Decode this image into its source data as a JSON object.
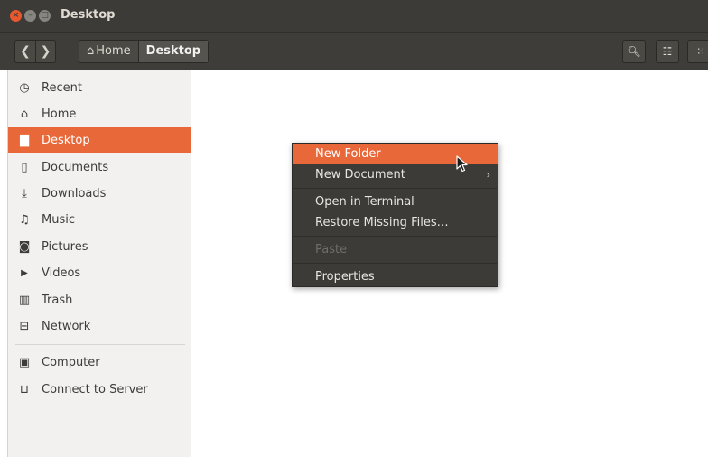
{
  "window": {
    "title": "Desktop",
    "controls": {
      "close": "×",
      "minimize": "–",
      "maximize": "□"
    }
  },
  "toolbar": {
    "back_glyph": "❮",
    "forward_glyph": "❯",
    "breadcrumbs": [
      {
        "label": "Home",
        "icon": "home-icon",
        "glyph": "⌂"
      },
      {
        "label": "Desktop"
      }
    ],
    "search_glyph": "🔍︎",
    "list_view_glyph": "☷",
    "grid_view_glyph": "⁙"
  },
  "sidebar": {
    "items": [
      {
        "label": "Recent",
        "icon": "clock-icon",
        "glyph": "◷"
      },
      {
        "label": "Home",
        "icon": "home-icon",
        "glyph": "⌂"
      },
      {
        "label": "Desktop",
        "icon": "folder-icon",
        "glyph": "▇",
        "selected": true
      },
      {
        "label": "Documents",
        "icon": "document-icon",
        "glyph": "▯"
      },
      {
        "label": "Downloads",
        "icon": "download-icon",
        "glyph": "⤓"
      },
      {
        "label": "Music",
        "icon": "music-icon",
        "glyph": "♫"
      },
      {
        "label": "Pictures",
        "icon": "camera-icon",
        "glyph": "◙"
      },
      {
        "label": "Videos",
        "icon": "video-icon",
        "glyph": "▶"
      },
      {
        "label": "Trash",
        "icon": "trash-icon",
        "glyph": "▥"
      },
      {
        "label": "Network",
        "icon": "network-icon",
        "glyph": "⊟"
      },
      {
        "label": "Computer",
        "icon": "computer-icon",
        "glyph": "▣"
      },
      {
        "label": "Connect to Server",
        "icon": "server-icon",
        "glyph": "⊔"
      }
    ]
  },
  "context_menu": {
    "items": [
      {
        "label": "New Folder",
        "state": "highlighted"
      },
      {
        "label": "New Document",
        "submenu_glyph": "›"
      },
      {
        "label": "Open in Terminal"
      },
      {
        "label": "Restore Missing Files…"
      },
      {
        "label": "Paste",
        "state": "disabled"
      },
      {
        "label": "Properties"
      }
    ]
  },
  "colors": {
    "accent": "#e9683a",
    "titlebar": "#3c3b37",
    "menu_bg": "#3c3b37",
    "sidebar_bg": "#f2f1f0"
  }
}
